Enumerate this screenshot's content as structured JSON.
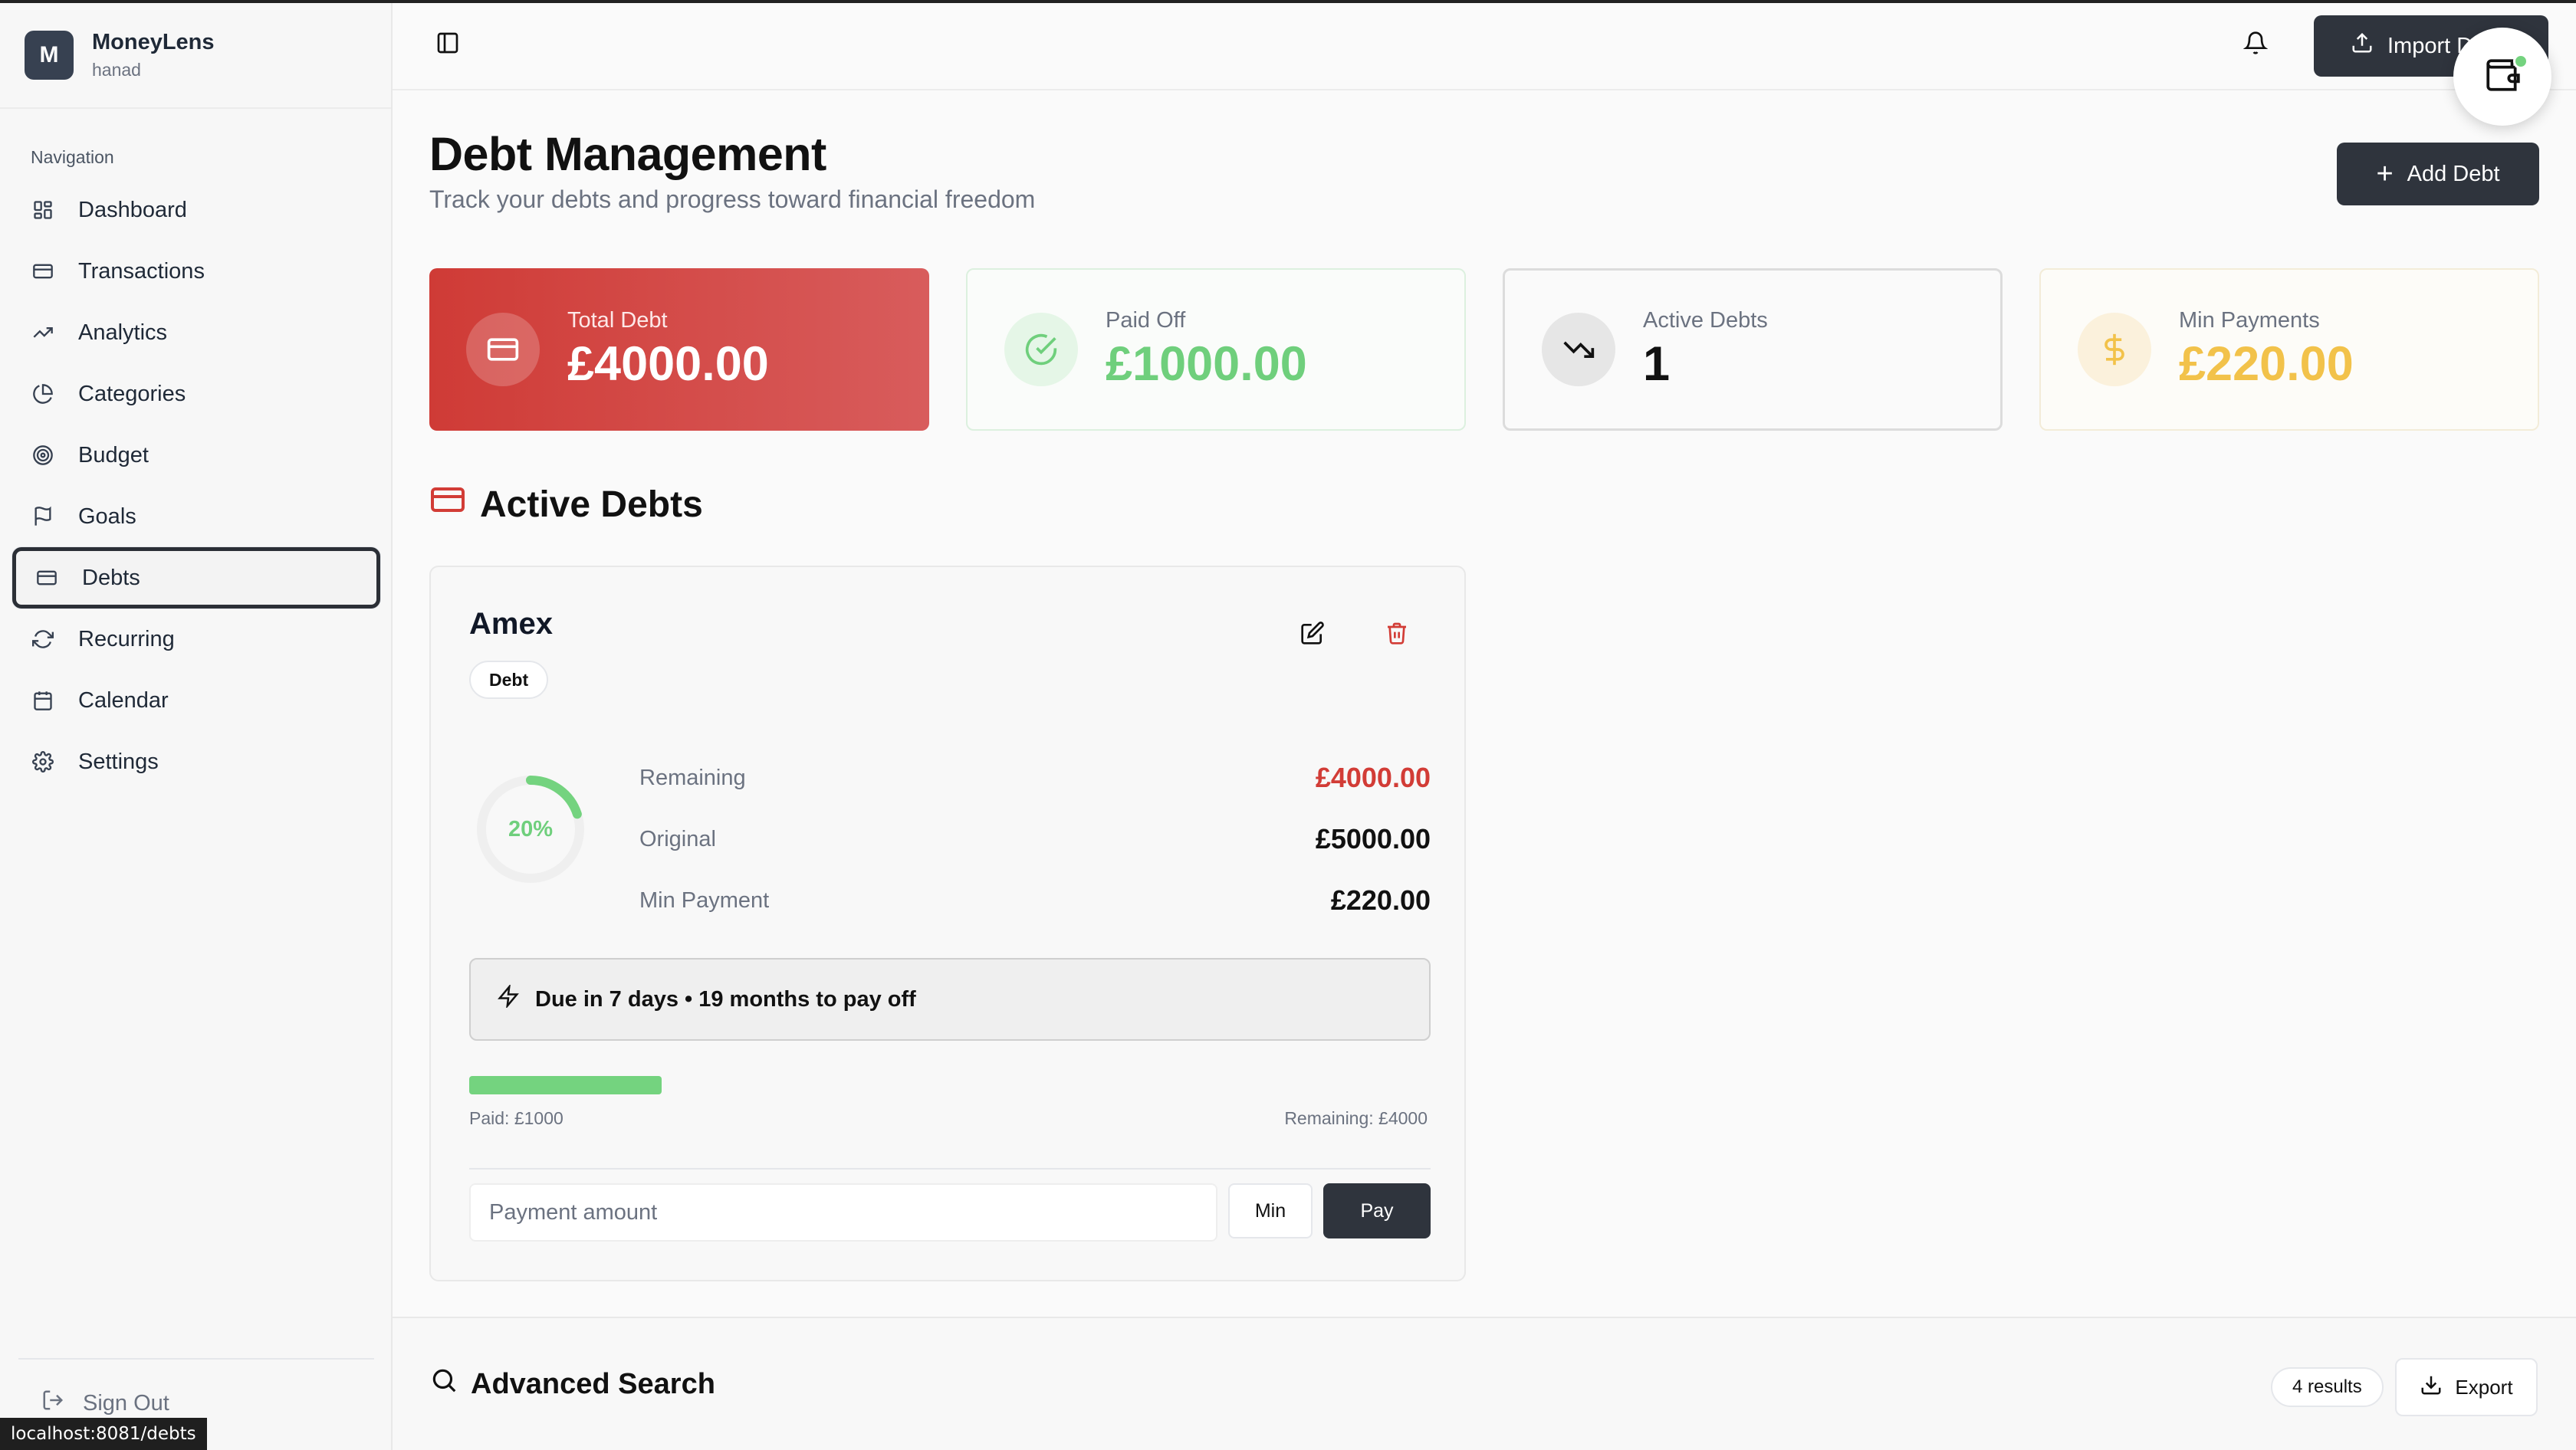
{
  "brand": {
    "initial": "M",
    "name": "MoneyLens",
    "user": "hanad"
  },
  "sidebar": {
    "nav_title": "Navigation",
    "items": [
      {
        "label": "Dashboard",
        "icon": "grid-icon"
      },
      {
        "label": "Transactions",
        "icon": "card-icon"
      },
      {
        "label": "Analytics",
        "icon": "trending-up-icon"
      },
      {
        "label": "Categories",
        "icon": "pie-chart-icon"
      },
      {
        "label": "Budget",
        "icon": "target-icon"
      },
      {
        "label": "Goals",
        "icon": "flag-icon"
      },
      {
        "label": "Debts",
        "icon": "card-icon",
        "active": true
      },
      {
        "label": "Recurring",
        "icon": "refresh-icon"
      },
      {
        "label": "Calendar",
        "icon": "calendar-icon"
      },
      {
        "label": "Settings",
        "icon": "gear-icon"
      }
    ],
    "sign_out": "Sign Out"
  },
  "status_url": "localhost:8081/debts",
  "header": {
    "import_label": "Import D"
  },
  "page": {
    "title": "Debt Management",
    "subtitle": "Track your debts and progress toward financial freedom",
    "add_debt_label": "Add Debt"
  },
  "stats": {
    "total": {
      "label": "Total Debt",
      "value": "£4000.00"
    },
    "paid": {
      "label": "Paid Off",
      "value": "£1000.00"
    },
    "active": {
      "label": "Active Debts",
      "value": "1"
    },
    "min": {
      "label": "Min Payments",
      "value": "£220.00"
    }
  },
  "active_section": {
    "title": "Active Debts"
  },
  "debt": {
    "name": "Amex",
    "badge": "Debt",
    "progress_percent": 20,
    "progress_label": "20%",
    "rows": [
      {
        "label": "Remaining",
        "value": "£4000.00"
      },
      {
        "label": "Original",
        "value": "£5000.00"
      },
      {
        "label": "Min Payment",
        "value": "£220.00"
      }
    ],
    "due_text": "Due in 7 days • 19 months to pay off",
    "paid_label": "Paid: £1000",
    "remaining_label": "Remaining: £4000",
    "payment_placeholder": "Payment amount",
    "min_label": "Min",
    "pay_label": "Pay"
  },
  "search": {
    "title": "Advanced Search",
    "results": "4 results",
    "export_label": "Export"
  },
  "colors": {
    "accent": "#2f343d",
    "danger": "#d23c36",
    "success": "#74d37f",
    "warning": "#f2c24a"
  }
}
